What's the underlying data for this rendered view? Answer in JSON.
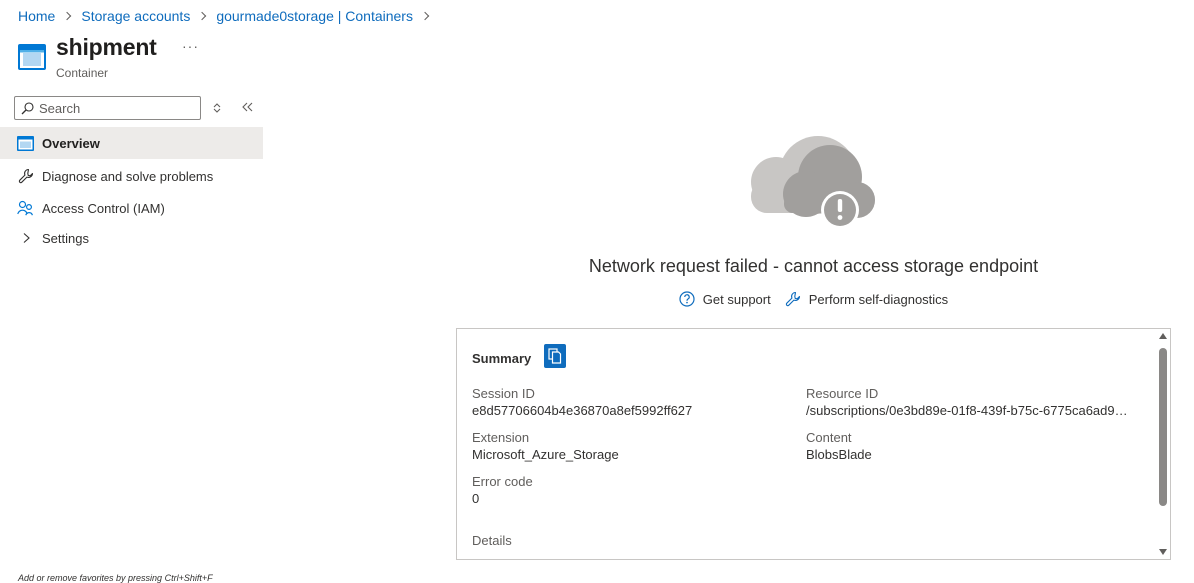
{
  "breadcrumb": [
    "Home",
    "Storage accounts",
    "gourmade0storage | Containers"
  ],
  "header": {
    "title": "shipment",
    "subtitle": "Container",
    "more": "···"
  },
  "sidebar": {
    "search_placeholder": "Search",
    "items": [
      {
        "label": "Overview",
        "icon": "container-icon",
        "active": true
      },
      {
        "label": "Diagnose and solve problems",
        "icon": "wrench-icon"
      },
      {
        "label": "Access Control (IAM)",
        "icon": "people-icon"
      },
      {
        "label": "Settings",
        "icon": "chevron-right-icon"
      }
    ]
  },
  "main": {
    "error_title": "Network request failed - cannot access storage endpoint",
    "links": {
      "support": "Get support",
      "diagnostics": "Perform self-diagnostics"
    },
    "summary": {
      "title": "Summary",
      "fields": {
        "session_id_label": "Session ID",
        "session_id": "e8d57706604b4e36870a8ef5992ff627",
        "resource_id_label": "Resource ID",
        "resource_id": "/subscriptions/0e3bd89e-01f8-439f-b75c-6775ca6ad9…",
        "extension_label": "Extension",
        "extension": "Microsoft_Azure_Storage",
        "content_label": "Content",
        "content": "BlobsBlade",
        "error_code_label": "Error code",
        "error_code": "0",
        "details_label": "Details"
      }
    }
  },
  "footer": {
    "hint": "Add or remove favorites by pressing Ctrl+Shift+F"
  },
  "colors": {
    "link": "#0f6cbd",
    "active_nav": "#edebe9",
    "cloud": "#c8c6c4",
    "accent": "#0f6cbd"
  }
}
